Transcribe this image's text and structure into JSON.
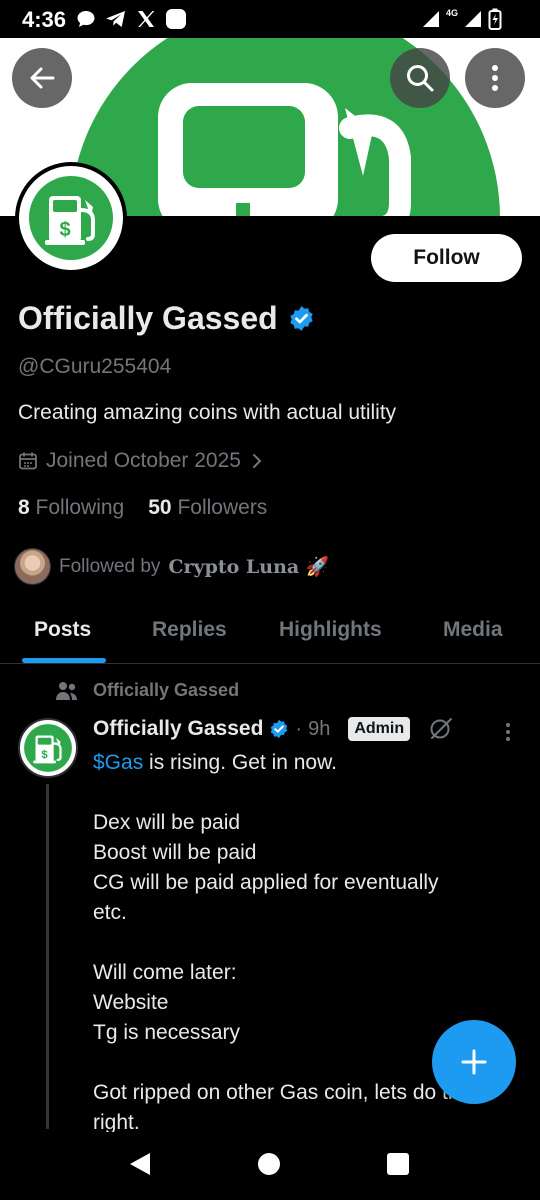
{
  "status_bar": {
    "time": "4:36",
    "network": "4G"
  },
  "profile": {
    "display_name": "Officially Gassed",
    "handle": "@CGuru255404",
    "bio": "Creating amazing coins with actual utility",
    "joined": "Joined October 2025",
    "following_count": "8",
    "following_label": "Following",
    "followers_count": "50",
    "followers_label": "Followers",
    "followed_by_prefix": "Followed by",
    "followed_by_name": "Crypto Luna 🚀",
    "follow_button": "Follow"
  },
  "tabs": [
    {
      "label": "Posts",
      "active": true
    },
    {
      "label": "Replies",
      "active": false
    },
    {
      "label": "Highlights",
      "active": false
    },
    {
      "label": "Media",
      "active": false
    }
  ],
  "post": {
    "pinned_label": "Officially Gassed",
    "author": "Officially Gassed",
    "separator": "·",
    "time": "9h",
    "badge": "Admin",
    "cashtag": "$Gas",
    "lines": [
      " is rising.  Get in now.",
      "",
      "Dex will be paid",
      "Boost will be paid",
      "CG will be paid applied for eventually",
      "etc.",
      "",
      "Will come later:",
      "Website",
      "Tg is necessary",
      "",
      "Got ripped on other Gas coin, lets do this",
      "right."
    ]
  },
  "colors": {
    "accent": "#1d9bf0",
    "brand_green": "#2ea84a",
    "background": "#000000",
    "muted_text": "#71767b"
  },
  "icons": [
    "back-arrow-icon",
    "search-icon",
    "more-vertical-icon",
    "verified-badge-icon",
    "calendar-icon",
    "chevron-right-icon",
    "community-icon",
    "gas-pump-icon",
    "plus-icon"
  ]
}
